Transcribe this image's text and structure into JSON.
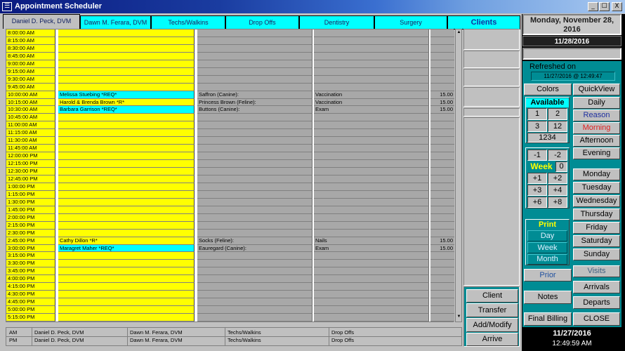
{
  "window": {
    "title": "Appointment Scheduler",
    "minimize": "_",
    "maximize": "☐",
    "close": "X",
    "app_icon": "☰"
  },
  "tabs": [
    "Daniel D. Peck, DVM",
    "Dawn M. Ferara, DVM",
    "Techs/Walkins",
    "Drop Offs",
    "Dentistry",
    "Surgery",
    "Clients"
  ],
  "header_date": "Monday, November 28, 2016",
  "selected_date": "11/28/2016",
  "refreshed_label": "Refreshed on",
  "refreshed_value": "11/27/2016 @ 12:49:47",
  "buttons": {
    "colors": "Colors",
    "quickview": "QuickView",
    "daily": "Daily",
    "reason": "Reason",
    "morning": "Morning",
    "afternoon": "Afternoon",
    "evening": "Evening",
    "monday": "Monday",
    "tuesday": "Tuesday",
    "wednesday": "Wednesday",
    "thursday": "Thursday",
    "friday": "Friday",
    "saturday": "Saturday",
    "sunday": "Sunday",
    "visits": "Visits",
    "arrivals": "Arrivals",
    "departs": "Departs",
    "close": "CLOSE",
    "prior": "Prior",
    "notes": "Notes",
    "final_billing": "Final Billing",
    "client": "Client",
    "transfer": "Transfer",
    "add_modify": "Add/Modify",
    "arrive": "Arrive"
  },
  "available": {
    "label": "Available",
    "cells": [
      "1",
      "2",
      "3",
      "12",
      "1234"
    ]
  },
  "week": {
    "label": "Week",
    "cells": [
      "-1",
      "-2",
      "0",
      "+1",
      "+2",
      "+3",
      "+4",
      "+6",
      "+8"
    ]
  },
  "print": {
    "label": "Print",
    "day": "Day",
    "week": "Week",
    "month": "Month"
  },
  "colors": {
    "accent_teal": "#008c94",
    "slot_yellow": "#ffff00",
    "req_cyan": "#00ffff",
    "morning_text": "#e02020"
  },
  "schedule": [
    {
      "time": "8:00:00 AM"
    },
    {
      "time": "8:15:00 AM"
    },
    {
      "time": "8:30:00 AM"
    },
    {
      "time": "8:45:00 AM"
    },
    {
      "time": "9:00:00 AM"
    },
    {
      "time": "9:15:00 AM"
    },
    {
      "time": "9:30:00 AM"
    },
    {
      "time": "9:45:00 AM"
    },
    {
      "time": "10:00:00 AM",
      "client": "Melissa Stuebing *REQ*",
      "patient": "Saffron (Canine):",
      "reason": "Vaccination",
      "fee": "15.00",
      "req": true
    },
    {
      "time": "10:15:00 AM",
      "client": "Harold & Brenda Brown *R*",
      "patient": "Princess Brown (Feline):",
      "reason": "Vaccination",
      "fee": "15.00"
    },
    {
      "time": "10:30:00 AM",
      "client": "Barbara Garrison *REQ*",
      "patient": "Buttons (Canine):",
      "reason": "Exam",
      "fee": "15.00",
      "req": true
    },
    {
      "time": "10:45:00 AM"
    },
    {
      "time": "11:00:00 AM"
    },
    {
      "time": "11:15:00 AM"
    },
    {
      "time": "11:30:00 AM"
    },
    {
      "time": "11:45:00 AM"
    },
    {
      "time": "12:00:00 PM"
    },
    {
      "time": "12:15:00 PM"
    },
    {
      "time": "12:30:00 PM"
    },
    {
      "time": "12:45:00 PM"
    },
    {
      "time": "1:00:00 PM"
    },
    {
      "time": "1:15:00 PM"
    },
    {
      "time": "1:30:00 PM"
    },
    {
      "time": "1:45:00 PM"
    },
    {
      "time": "2:00:00 PM"
    },
    {
      "time": "2:15:00 PM"
    },
    {
      "time": "2:30:00 PM"
    },
    {
      "time": "2:45:00 PM",
      "client": "Cathy Dillon *R*",
      "patient": "Socks (Feline):",
      "reason": "Nails",
      "fee": "15.00"
    },
    {
      "time": "3:00:00 PM",
      "client": "Maragret Maher *REQ*",
      "patient": "Eauregard (Canine):",
      "reason": "Exam",
      "fee": "15.00",
      "req": true
    },
    {
      "time": "3:15:00 PM"
    },
    {
      "time": "3:30:00 PM"
    },
    {
      "time": "3:45:00 PM"
    },
    {
      "time": "4:00:00 PM"
    },
    {
      "time": "4:15:00 PM"
    },
    {
      "time": "4:30:00 PM"
    },
    {
      "time": "4:45:00 PM"
    },
    {
      "time": "5:00:00 PM"
    },
    {
      "time": "5:15:00 PM"
    }
  ],
  "footer": {
    "am": [
      "AM",
      "Daniel D. Peck, DVM",
      "Dawn M. Ferara, DVM",
      "Techs/Walkins",
      "Drop Offs"
    ],
    "pm": [
      "PM",
      "Daniel D. Peck, DVM",
      "Dawn M. Ferara, DVM",
      "Techs/Walkins",
      "Drop Offs"
    ]
  },
  "clock": {
    "date": "11/27/2016",
    "time": "12:49:59 AM"
  }
}
